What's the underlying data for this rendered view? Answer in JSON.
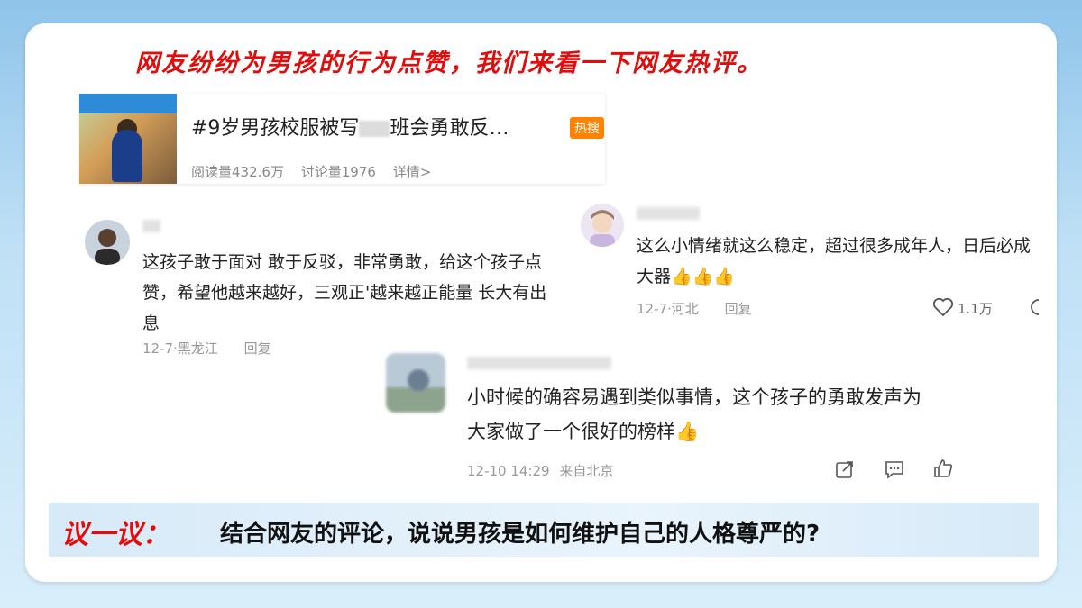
{
  "headline": "网友纷纷为男孩的行为点赞，我们来看一下网友热评。",
  "topic": {
    "title_prefix": "#9岁男孩校服被写",
    "title_suffix": "班会勇敢反…",
    "badge": "热搜",
    "reads": "阅读量432.6万",
    "discussions": "讨论量1976",
    "details": "详情>"
  },
  "comments": [
    {
      "text": "这孩子敢于面对 敢于反驳，非常勇敢，给这个孩子点赞，希望他越来越好，三观正'越来越正能量 长大有出息",
      "time": "12-7·黑龙江",
      "reply": "回复"
    },
    {
      "text": "这么小情绪就这么稳定，超过很多成年人，日后必成大器👍👍👍",
      "time": "12-7·河北",
      "reply": "回复",
      "likes": "1.1万"
    },
    {
      "text": "小时候的确容易遇到类似事情，这个孩子的勇敢发声为大家做了一个很好的榜样👍",
      "time": "12-10 14:29",
      "source": "来自北京"
    }
  ],
  "discussion": {
    "label": "议一议：",
    "question": "结合网友的评论，说说男孩是如何维护自己的人格尊严的?"
  },
  "colors": {
    "accent_red": "#e00d0d",
    "hot_badge": "#ff8200"
  }
}
